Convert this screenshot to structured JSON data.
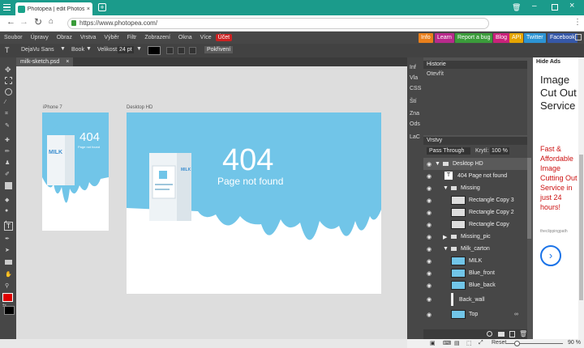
{
  "browser": {
    "tab_title": "Photopea | edit Photoshop f",
    "url": "https://www.photopea.com/"
  },
  "menu": [
    "Soubor",
    "Úpravy",
    "Obraz",
    "Vrstva",
    "Výběr",
    "Filtr",
    "Zobrazení",
    "Okna",
    "Více"
  ],
  "menu_account": "Účet",
  "links": [
    {
      "label": "Info",
      "color": "#e97f1b"
    },
    {
      "label": "Learn",
      "color": "#b82a8c"
    },
    {
      "label": "Report a bug",
      "color": "#3a9c3a"
    },
    {
      "label": "Blog",
      "color": "#c9217a"
    },
    {
      "label": "API",
      "color": "#e6a400"
    },
    {
      "label": "Twitter",
      "color": "#2c94d4"
    },
    {
      "label": "Facebook",
      "color": "#3658a8"
    }
  ],
  "toolbar": {
    "font": "DejaVu Sans",
    "style": "Book",
    "size_label": "Velikost:",
    "size": "24 pt",
    "adv_button": "Pokřivení"
  },
  "doc": {
    "tab": "milk-sketch.psd"
  },
  "artboards": {
    "iphone_label": "iPhone 7",
    "desktop_label": "Desktop HD",
    "big": "404",
    "sub": "Page not found",
    "milk": "MILK"
  },
  "side_tabs": [
    "Inf",
    "Vla",
    "CSS",
    "Ští",
    "Zna",
    "Ods",
    "LaC"
  ],
  "history": {
    "title": "Historie",
    "items": [
      "Otevřít"
    ]
  },
  "layers": {
    "title": "Vrstvy",
    "blend": "Pass Through",
    "opacity_label": "Krytí:",
    "opacity": "100 %",
    "items": [
      {
        "name": "Desktop HD",
        "kind": "folder"
      },
      {
        "name": "404 Page not found",
        "kind": "text"
      },
      {
        "name": "Missing",
        "kind": "folder"
      },
      {
        "name": "Rectangle Copy 3",
        "kind": "shape"
      },
      {
        "name": "Rectangle Copy 2",
        "kind": "shape"
      },
      {
        "name": "Rectangle Copy",
        "kind": "shape"
      },
      {
        "name": "Missing_pic",
        "kind": "folder"
      },
      {
        "name": "Milk_carton",
        "kind": "folder"
      },
      {
        "name": "MILK",
        "kind": "img"
      },
      {
        "name": "Blue_front",
        "kind": "img"
      },
      {
        "name": "Blue_back",
        "kind": "img"
      },
      {
        "name": "Back_wall",
        "kind": "img"
      },
      {
        "name": "Top",
        "kind": "img"
      }
    ]
  },
  "ads": {
    "hide": "Hide Ads",
    "headline": "Image Cut Out Service",
    "body": "Fast & Affordable Image Cutting Out Service in just 24 hours!",
    "domain": "theclippingpath"
  },
  "status": {
    "reset": "Reset",
    "zoom": "90 %"
  },
  "colors": {
    "accent": "#1b9b8b",
    "sky": "#71c5e8",
    "fg": "#e00000",
    "bg": "#000000"
  }
}
